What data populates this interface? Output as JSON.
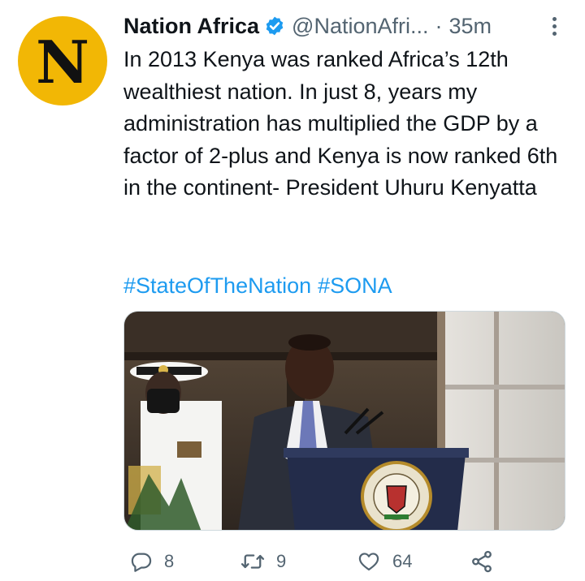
{
  "account": {
    "avatar_letter": "N",
    "avatar_color": "#f2b705",
    "name": "Nation Africa",
    "handle": "@NationAfri...",
    "separator": "·",
    "timestamp": "35m"
  },
  "tweet": {
    "text": "In 2013 Kenya was ranked Africa’s 12th wealthiest nation. In just 8, years my administration has multiplied the GDP by a factor of 2-plus and Kenya is now ranked 6th in the continent- President Uhuru Kenyatta",
    "hashtags": [
      "#StateOfTheNation",
      "#SONA"
    ],
    "image_alt": "photo"
  },
  "stats": {
    "replies": "8",
    "retweets": "9",
    "likes": "64"
  },
  "colors": {
    "accent": "#1d9bf0",
    "muted": "#536471",
    "text": "#0f1419"
  },
  "icons": {
    "verified": "verified-badge-icon",
    "more": "more-options-icon",
    "reply": "reply-icon",
    "retweet": "retweet-icon",
    "like": "like-icon",
    "share": "share-icon"
  }
}
